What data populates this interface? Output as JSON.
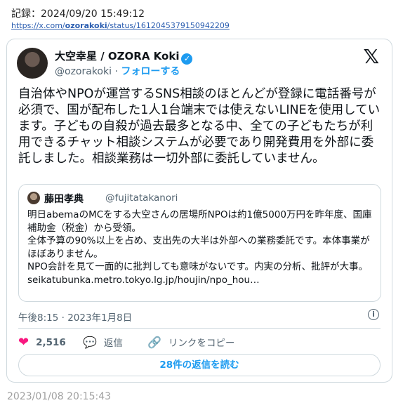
{
  "record": "記録：2024/09/20 15:49:12",
  "url": {
    "prefix": "https://x.com/",
    "user": "ozorakoki",
    "suffix": "/status/1612045379150942209"
  },
  "tweet": {
    "author_name": "大空幸星 / OZORA Koki",
    "handle": "@ozorakoki",
    "separator": "·",
    "follow_label": "フォローする",
    "text": "自治体やNPOが運営するSNS相談のほとんどが登録に電話番号が必須で、国が配布した1人1台端末では使えないLINEを使用しています。子どもの自殺が過去最多となる中、全ての子どもたちが利用できるチャット相談システムが必要であり開発費用を外部に委託しました。相談業務は一切外部に委託していません。",
    "quoted": {
      "author_name": "藤田孝典",
      "handle": "@fujitatakanori",
      "lines": [
        "明日abemaのMCをする大空さんの居場所NPOは約1億5000万円を昨年度、国庫補助金（税金）から受領。",
        "全体予算の90%以上を占め、支出先の大半は外部への業務委託です。本体事業がほぼありません。",
        "NPO会計を見て一面的に批判しても意味がないです。内実の分析、批評が大事。",
        "seikatubunka.metro.tokyo.lg.jp/houjin/npo_hou…"
      ]
    },
    "timestamp": "午後8:15 · 2023年1月8日",
    "likes": "2,516",
    "reply_label": "返信",
    "copy_link_label": "リンクをコピー",
    "read_replies_label": "28件の返信を読む"
  },
  "saved_date": "2023/01/08 20:15:43",
  "icons": {
    "x_logo": "𝕏",
    "verified": "✓",
    "heart": "❤",
    "bubble": "💬",
    "link": "🔗",
    "info": "i"
  },
  "colors": {
    "accent": "#1d9bf0",
    "like": "#f91880",
    "muted": "#536471"
  }
}
